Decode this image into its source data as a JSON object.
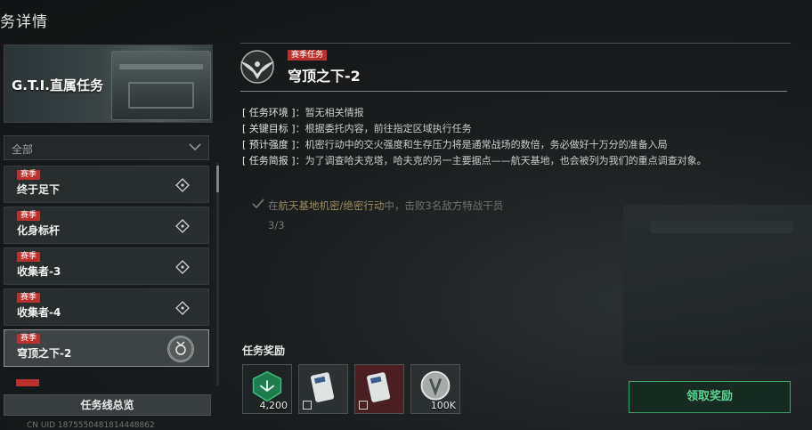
{
  "page": {
    "title": "务详情"
  },
  "banner": {
    "title": "G.T.I.直属任务"
  },
  "filter": {
    "selected": "全部",
    "icon": "chevron-down-icon"
  },
  "quests": [
    {
      "badge": "赛季",
      "name": "终于足下",
      "icon": "location-pin-icon",
      "active": false
    },
    {
      "badge": "赛季",
      "name": "化身标杆",
      "icon": "location-pin-icon",
      "active": false
    },
    {
      "badge": "赛季",
      "name": "收集者-3",
      "icon": "location-pin-icon",
      "active": false
    },
    {
      "badge": "赛季",
      "name": "收集者-4",
      "icon": "location-pin-icon",
      "active": false
    },
    {
      "badge": "赛季",
      "name": "穹顶之下-2",
      "icon": "medal-icon",
      "active": true
    }
  ],
  "overview_button": "任务线总览",
  "uid": "CN UID 1875550481814448862",
  "mission": {
    "tag": "赛季任务",
    "title": "穹顶之下-2",
    "emblem": "eagle-wing-emblem-icon",
    "info": [
      {
        "key": "[ 任务环境 ]",
        "value": "暂无相关情报"
      },
      {
        "key": "[ 关键目标 ]",
        "value": "根据委托内容，前往指定区域执行任务"
      },
      {
        "key": "[ 预计强度 ]",
        "value": "机密行动中的交火强度和生存压力将是通常战场的数倍，务必做好十万分的准备入局"
      },
      {
        "key": "[ 任务简报 ]",
        "value": "为了调查哈夫克塔，哈夫克的另一主要据点——航天基地，也会被列为我们的重点调查对象。"
      }
    ],
    "objective": {
      "prefix": "在",
      "highlight": "航天基地机密/绝密行动",
      "suffix": "中，击败3名敌方特战干员",
      "progress": "3/3"
    }
  },
  "rewards": {
    "title": "任务奖励",
    "items": [
      {
        "icon": "green-emblem-icon",
        "count": "4,200"
      },
      {
        "icon": "keycard-icon",
        "count": ""
      },
      {
        "icon": "keycard-red-icon",
        "count": ""
      },
      {
        "icon": "silver-coin-icon",
        "count": "100K"
      }
    ]
  },
  "claim_button": "领取奖励",
  "colors": {
    "accent_red": "#b9312c",
    "accent_green": "#3ea36a"
  }
}
